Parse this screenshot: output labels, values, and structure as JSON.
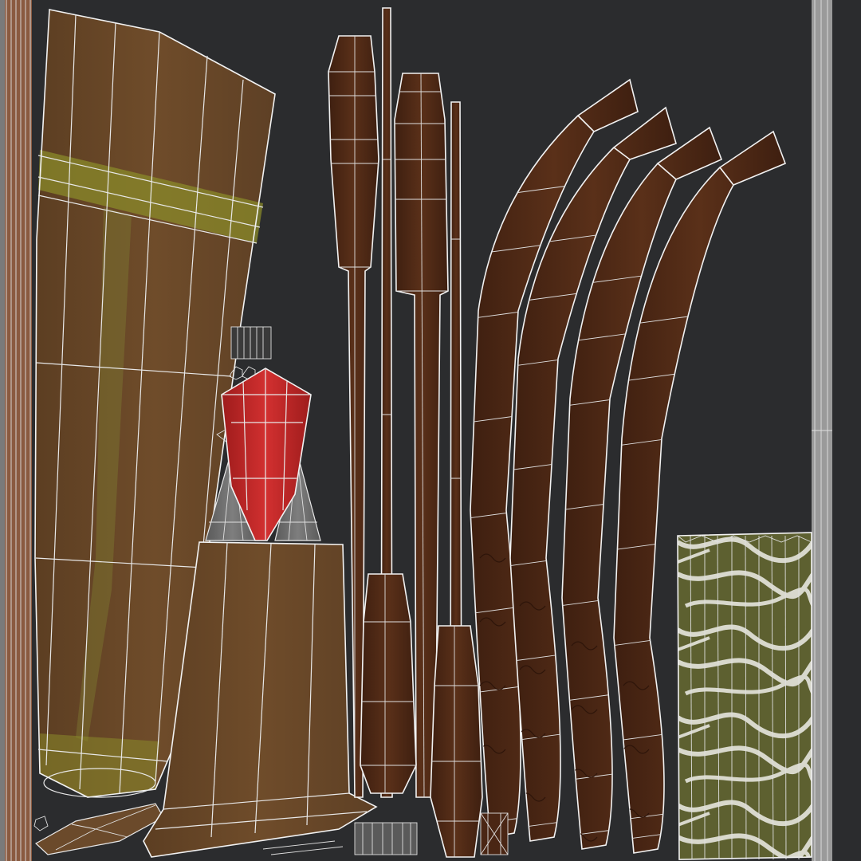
{
  "viewport": {
    "background_color": "#2b2c2e"
  },
  "colors": {
    "cloth_brown": "#6b4a2b",
    "cloth_brown_light": "#7a5632",
    "cloth_band_olive": "#8a8a2a",
    "wood_dark": "#4a2614",
    "wood_mid": "#5a3019",
    "wood_grain": "#3a1c0e",
    "gem_red": "#c42a2a",
    "gem_red_dark": "#8e1a1a",
    "metal_grey": "#6d6d6d",
    "foliage_green": "#5d6030",
    "foliage_white": "#dcdcd0",
    "uv_wire": "#e8e8e8",
    "border_strip": "#9a9a9a"
  },
  "uv_islands": [
    {
      "name": "cloth-sleeve-island",
      "material": "cloth"
    },
    {
      "name": "cloth-base-island",
      "material": "cloth"
    },
    {
      "name": "gem-island",
      "material": "gem"
    },
    {
      "name": "metal-cone-island",
      "material": "metal"
    },
    {
      "name": "wood-plank-islands",
      "material": "wood"
    },
    {
      "name": "curved-wood-islands",
      "material": "wood"
    },
    {
      "name": "foliage-island",
      "material": "foliage"
    },
    {
      "name": "left-border-strip",
      "material": "border"
    },
    {
      "name": "right-border-strip",
      "material": "border"
    }
  ]
}
